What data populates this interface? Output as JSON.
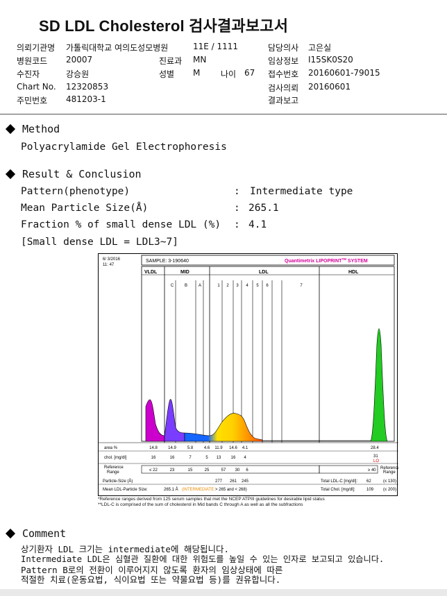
{
  "title": "SD LDL Cholesterol 검사결과보고서",
  "info": {
    "institution_k": "의뢰기관명",
    "institution_v": "가톨릭대학교 여의도성모병원",
    "ward_v": "11E / 1111",
    "doctor_k": "담당의사",
    "doctor_v": "고은실",
    "hospcode_k": "병원코드",
    "hospcode_v": "20007",
    "dept_k": "진료과",
    "dept_v": "MN",
    "clinical_k": "임상정보",
    "clinical_v": "I15SK0S20",
    "patient_k": "수진자",
    "patient_v": "강승원",
    "sex_k": "성별",
    "sex_v": "M",
    "age_k": "나이",
    "age_v": "67",
    "receipt_k": "접수번호",
    "receipt_v": "20160601-79015",
    "chart_k": "Chart No.",
    "chart_v": "12320853",
    "request_k": "검사의뢰",
    "request_v": "20160601",
    "resident_k": "주민번호",
    "resident_v": "481203-1",
    "report_k": "결과보고",
    "report_v": ""
  },
  "method": {
    "heading": "Method",
    "text": "Polyacrylamide Gel Electrophoresis"
  },
  "result": {
    "heading": "Result & Conclusion",
    "pattern_label": "Pattern(phenotype)",
    "pattern_value": "Intermediate type",
    "mps_label": "Mean Particle Size(Å)",
    "mps_value": "265.1",
    "fraction_label": "Fraction % of small dense LDL (%)",
    "fraction_value": "4.1",
    "note": "[Small dense LDL = LDL3~7]",
    "colon": ":"
  },
  "chart": {
    "date": "6/ 3/2016",
    "time": "11: 47",
    "sample": "SAMPLE:  3-190640",
    "brand": "Quantimetrix LIPOPRINT",
    "brand_tm": "TM",
    "brand_suffix": " SYSTEM",
    "vldl": "VLDL",
    "mid": "MID",
    "ldl": "LDL",
    "hdl": "HDL",
    "bands": [
      "C",
      "B",
      "A",
      "1",
      "2",
      "3",
      "4",
      "5",
      "6",
      "7"
    ],
    "area_label": "area %",
    "area_values": [
      "14.8",
      "14.9",
      "5.8",
      "4.6",
      "11.9",
      "14.6",
      "4.1"
    ],
    "area_hdl": "28.4",
    "chol_label": "chol. [mg/dl]",
    "chol_values": [
      "16",
      "16",
      "7",
      "5",
      "13",
      "16",
      "4"
    ],
    "chol_hdl": "31",
    "chol_hdl_flag": "LO",
    "ref_label": "Reference Range",
    "ref_values": [
      "≤ 22",
      "23",
      "15",
      "25",
      "57",
      "30",
      "6"
    ],
    "ref_hdl": "≥ 40",
    "ref_right": "Reference Range",
    "ps_label": "Particle-Size (Å)",
    "ps_values": [
      "277",
      "261",
      "245"
    ],
    "mean_label": "Mean LDL-Particle Size:",
    "mean_value": "265.1 Å",
    "mean_type": "(INTERMEDIATE:",
    "mean_range": "> 265 and < 268)",
    "total_ldl_label": "Total LDL-C [mg/dl]:",
    "total_ldl_value": "62",
    "total_ldl_ref": "(≤ 130)",
    "total_chol_label": "Total Chol. [mg/dl]:",
    "total_chol_value": "109",
    "total_chol_ref": "(≤ 200)"
  },
  "chart_data": {
    "type": "area",
    "title": "",
    "series": [
      {
        "name": "area %",
        "categories": [
          "VLDL",
          "MID C",
          "MID B",
          "MID A",
          "LDL1",
          "LDL2",
          "LDL3",
          "HDL"
        ],
        "values": [
          14.8,
          14.9,
          5.8,
          4.6,
          11.9,
          14.6,
          4.1,
          28.4
        ]
      },
      {
        "name": "chol. [mg/dl]",
        "categories": [
          "VLDL",
          "MID C",
          "MID B",
          "MID A",
          "LDL1",
          "LDL2",
          "LDL3",
          "HDL"
        ],
        "values": [
          16,
          16,
          7,
          5,
          13,
          16,
          4,
          31
        ]
      }
    ],
    "particle_size": {
      "LDL1": 277,
      "LDL2": 261,
      "LDL3": 245
    },
    "colors": {
      "vldl": "#cc00cc",
      "mid": "#6a3cff",
      "ldl_blue": "#1565ff",
      "ldl_yellow": "#ffe000",
      "ldl_orange": "#ff9800",
      "hdl": "#22cc22"
    }
  },
  "footnotes": {
    "line1": "*Reference ranges derived from 125 serum samples that met the NCEP ATPIII guidelines for desirable lipid status",
    "line2": "**LDL-C is comprised of the sum of cholesterol in Mid bands C through A as well as all the subfractions"
  },
  "comment": {
    "heading": "Comment",
    "lines": [
      "상기환자 LDL 크기는 intermediate에 해당됩니다.",
      "Intermediate LDL은 심혈관 질환에 대한 위험도를 높일 수 있는 인자로 보고되고 있습니다.",
      "Pattern B로의 전환이 이루어지지 않도록 환자의 임상상태에 따른",
      "적절한 치료(운동요법, 식이요법 또는 약물요법 등)를 권유합니다."
    ]
  }
}
